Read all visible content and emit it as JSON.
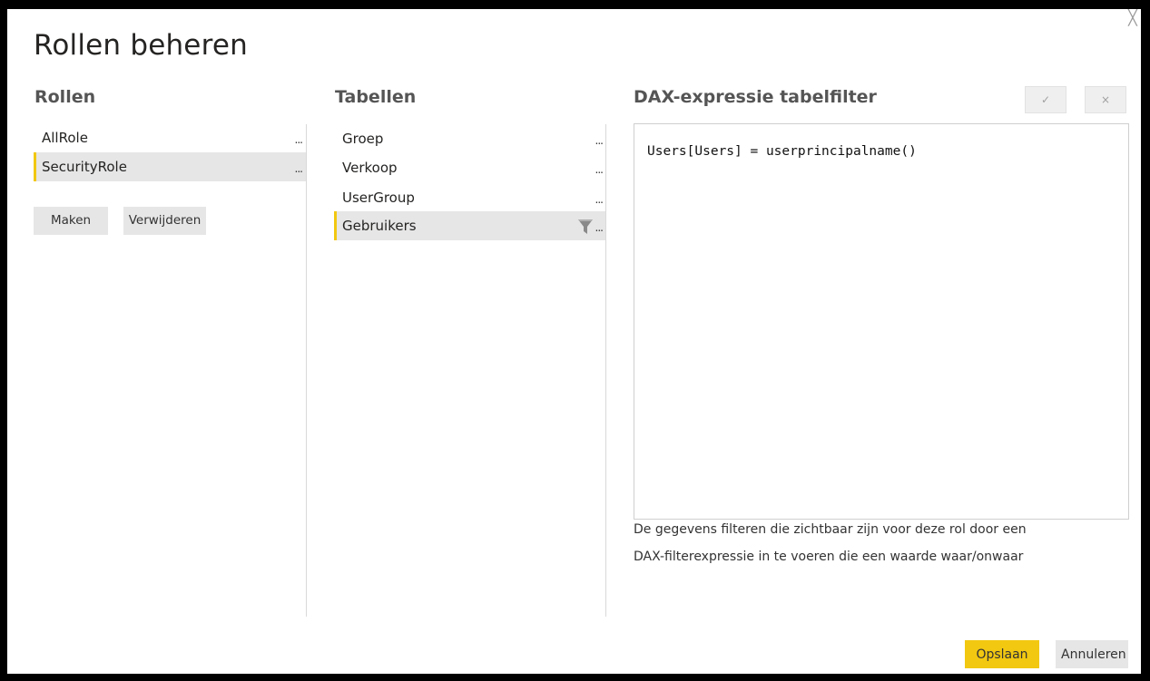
{
  "dialog": {
    "title": "Rollen beheren",
    "close_glyph": "╳"
  },
  "roles": {
    "header": "Rollen",
    "items": [
      {
        "label": "AllRole",
        "more": "..."
      },
      {
        "label": "SecurityRole",
        "more": "..."
      }
    ],
    "create_label": "Maken",
    "delete_label": "Verwijderen"
  },
  "tables": {
    "header": "Tabellen",
    "items": [
      {
        "label": "Groep",
        "more": "..."
      },
      {
        "label": "Verkoop",
        "more": "..."
      },
      {
        "label": "UserGroup",
        "more": "..."
      },
      {
        "label": "Gebruikers",
        "more": "...",
        "icon": "filter-icon"
      }
    ]
  },
  "dax": {
    "header": "DAX-expressie tabelfilter",
    "confirm_glyph": "✓",
    "cancel_glyph": "×",
    "expression": "Users[Users] = userprincipalname()",
    "help_line_1": "De gegevens filteren die zichtbaar zijn voor deze rol door een",
    "help_line_2": "DAX-filterexpressie in te voeren die een waarde waar/onwaar"
  },
  "footer": {
    "save_label": "Opslaan",
    "cancel_label": "Annuleren"
  },
  "colors": {
    "accent": "#f2c811",
    "selected_bg": "#e6e6e6"
  }
}
